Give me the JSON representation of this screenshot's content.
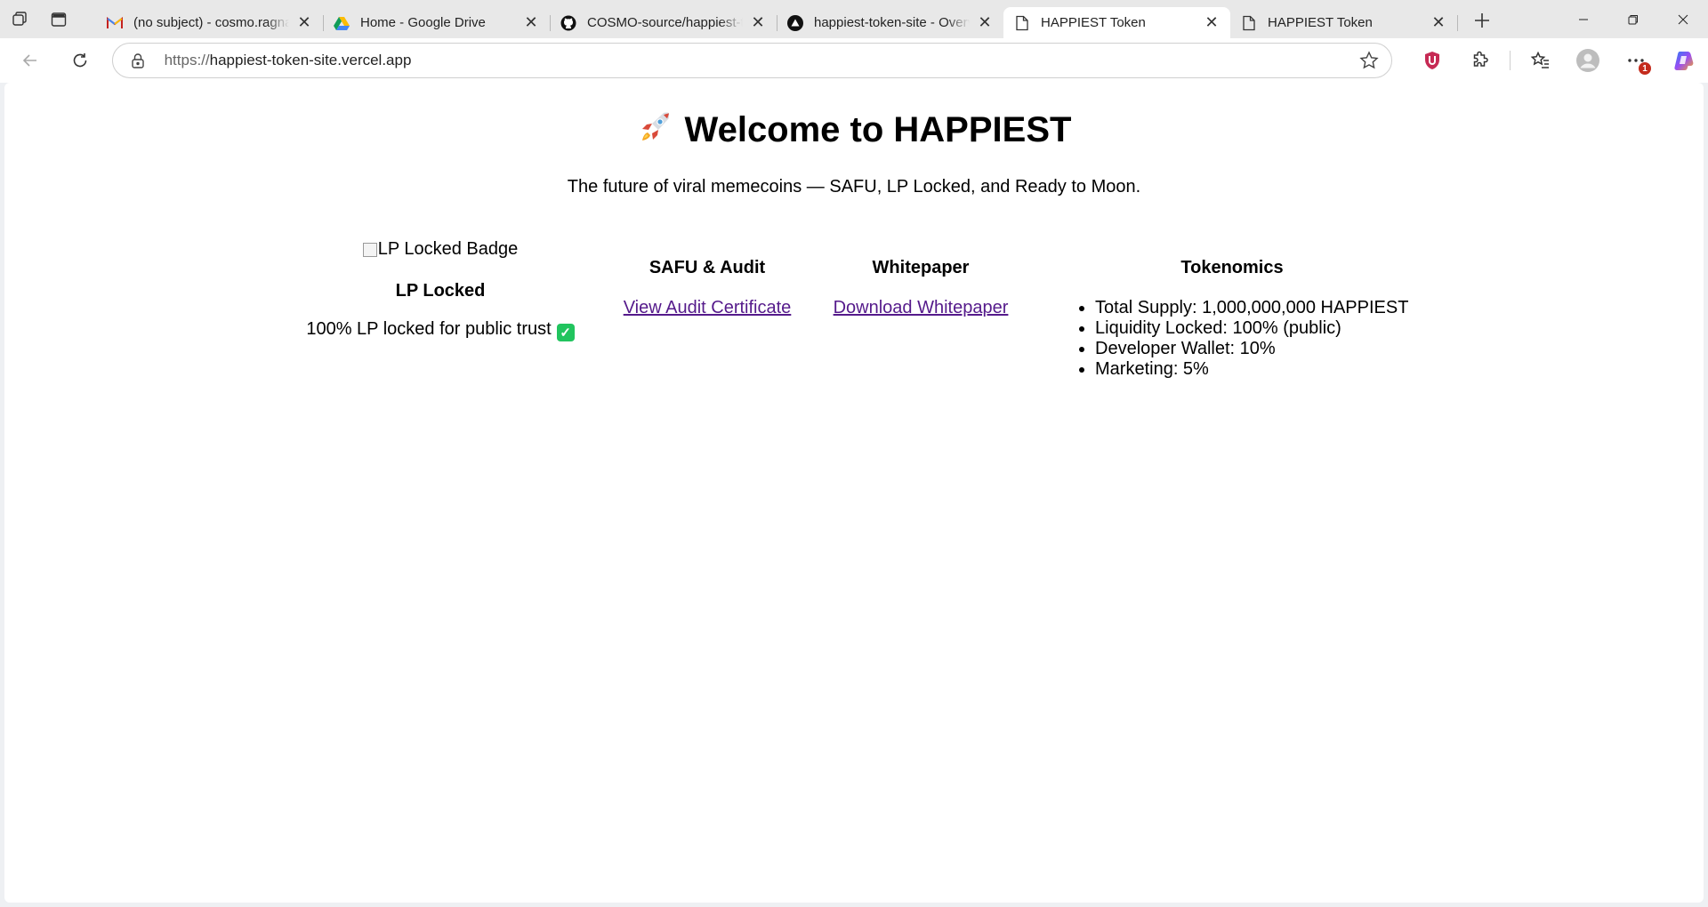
{
  "browser": {
    "tabs": [
      {
        "title": "(no subject) - cosmo.ragnar",
        "icon": "gmail-icon",
        "active": false
      },
      {
        "title": "Home - Google Drive",
        "icon": "google-drive-icon",
        "active": false
      },
      {
        "title": "COSMO-source/happiest-token",
        "icon": "github-icon",
        "active": false
      },
      {
        "title": "happiest-token-site - Overview",
        "icon": "vercel-icon",
        "active": false
      },
      {
        "title": "HAPPIEST Token",
        "icon": "page-icon",
        "active": true
      },
      {
        "title": "HAPPIEST Token",
        "icon": "page-icon",
        "active": false
      }
    ],
    "address": {
      "scheme": "https://",
      "host": "happiest-token-site.vercel.app"
    },
    "notification_count": "1"
  },
  "page": {
    "hero": {
      "emoji": "🚀",
      "title": "Welcome to HAPPIEST",
      "subtitle": "The future of viral memecoins — SAFU, LP Locked, and Ready to Moon."
    },
    "lp": {
      "image_alt": "LP Locked Badge",
      "heading": "LP Locked",
      "text": "100% LP locked for public trust"
    },
    "audit": {
      "heading": "SAFU & Audit",
      "link": "View Audit Certificate"
    },
    "whitepaper": {
      "heading": "Whitepaper",
      "link": "Download Whitepaper"
    },
    "tokenomics": {
      "heading": "Tokenomics",
      "items": [
        "Total Supply: 1,000,000,000 HAPPIEST",
        "Liquidity Locked: 100% (public)",
        "Developer Wallet: 10%",
        "Marketing: 5%"
      ]
    }
  },
  "colors": {
    "visited_link": "#551a8b",
    "check_green": "#21c45e"
  }
}
